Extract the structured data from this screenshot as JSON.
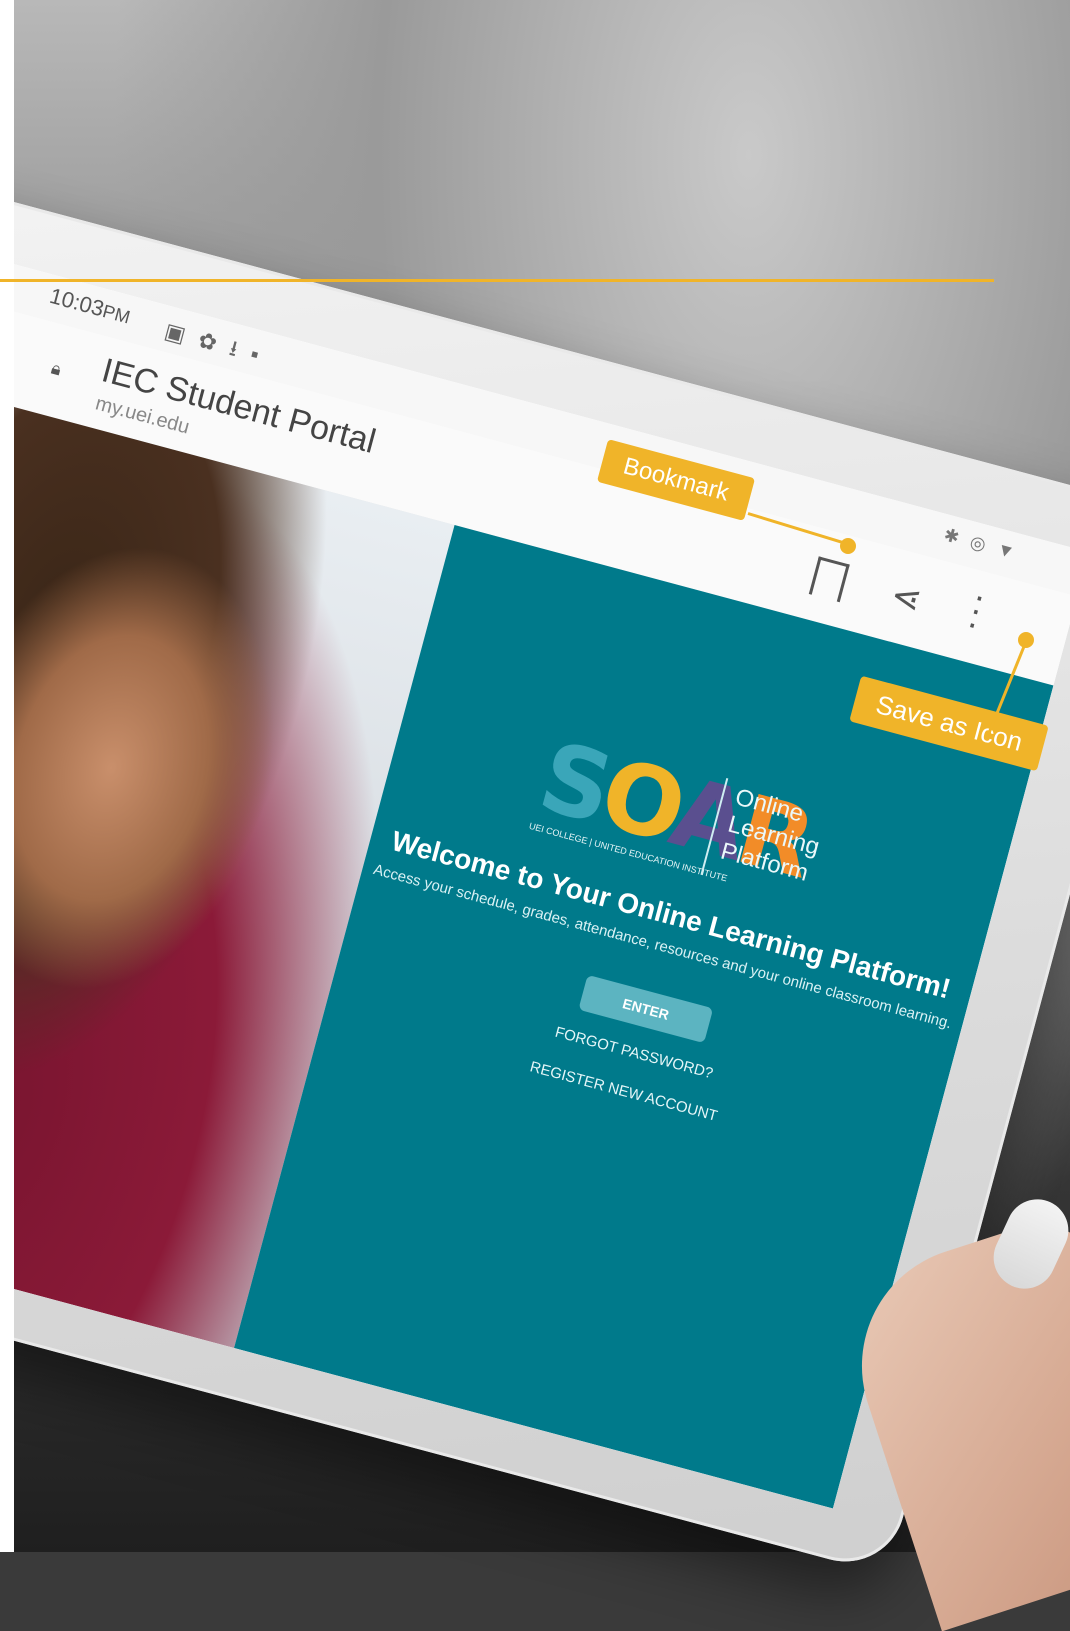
{
  "statusbar": {
    "time": "10:03",
    "ampm": "PM",
    "icons": [
      "gallery-icon",
      "gear-icon",
      "download-icon",
      "app-icon"
    ],
    "right_icons": [
      "bluetooth-icon",
      "vibrate-icon",
      "wifi-icon"
    ]
  },
  "appbar": {
    "back_icon": "back-arrow-icon",
    "title": "IEC Student Portal",
    "url": "my.uei.edu"
  },
  "panel": {
    "logo": {
      "word": "SOAR",
      "sub": "UEI COLLEGE | UNITED EDUCATION INSTITUTE",
      "tagline_1": "Online",
      "tagline_2": "Learning",
      "tagline_3": "Platform"
    },
    "welcome": "Welcome to Your Online Learning Platform!",
    "subtitle": "Access your schedule, grades, attendance, resources and your online classroom learning.",
    "enter_label": "ENTER",
    "forgot_label": "FORGOT PASSWORD?",
    "register_label": "REGISTER NEW ACCOUNT"
  },
  "callouts": {
    "bookmark": "Bookmark",
    "save_as_icon": "Save as Icon"
  },
  "colors": {
    "accent": "#f0b429",
    "panel": "#007a8b",
    "enter_button": "#5cb4c1"
  }
}
